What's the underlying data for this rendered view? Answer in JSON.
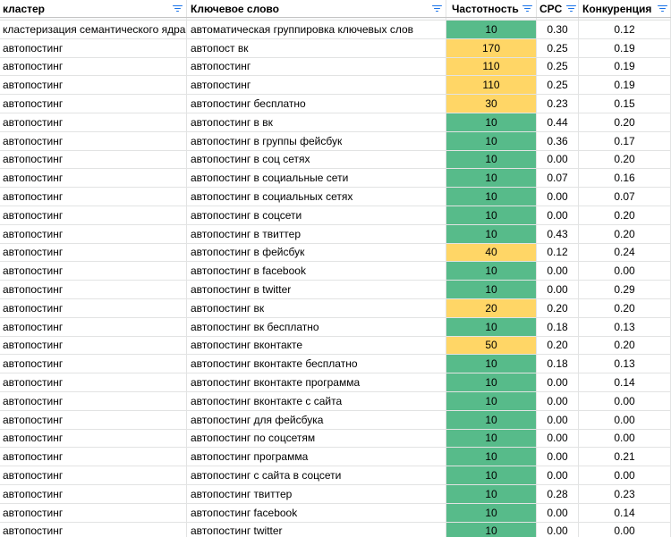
{
  "colors": {
    "high_frequency": "#ffd666",
    "low_frequency": "#57bb8a",
    "filter_icon": "#1a73e8"
  },
  "headers": [
    "кластер",
    "Ключевое слово",
    "Частотность",
    "CPC",
    "Конкуренция"
  ],
  "rows": [
    [
      "кластеризация семантического ядра",
      "автоматическая группировка ключевых слов",
      "10",
      "0.30",
      "0.12"
    ],
    [
      "автопостинг",
      "автопост вк",
      "170",
      "0.25",
      "0.19"
    ],
    [
      "автопостинг",
      "автопостинг",
      "110",
      "0.25",
      "0.19"
    ],
    [
      "автопостинг",
      "автопостинг",
      "110",
      "0.25",
      "0.19"
    ],
    [
      "автопостинг",
      "автопостинг бесплатно",
      "30",
      "0.23",
      "0.15"
    ],
    [
      "автопостинг",
      "автопостинг в вк",
      "10",
      "0.44",
      "0.20"
    ],
    [
      "автопостинг",
      "автопостинг в группы фейсбук",
      "10",
      "0.36",
      "0.17"
    ],
    [
      "автопостинг",
      "автопостинг в соц сетях",
      "10",
      "0.00",
      "0.20"
    ],
    [
      "автопостинг",
      "автопостинг в социальные сети",
      "10",
      "0.07",
      "0.16"
    ],
    [
      "автопостинг",
      "автопостинг в социальных сетях",
      "10",
      "0.00",
      "0.07"
    ],
    [
      "автопостинг",
      "автопостинг в соцсети",
      "10",
      "0.00",
      "0.20"
    ],
    [
      "автопостинг",
      "автопостинг в твиттер",
      "10",
      "0.43",
      "0.20"
    ],
    [
      "автопостинг",
      "автопостинг в фейсбук",
      "40",
      "0.12",
      "0.24"
    ],
    [
      "автопостинг",
      "автопостинг в facebook",
      "10",
      "0.00",
      "0.00"
    ],
    [
      "автопостинг",
      "автопостинг в twitter",
      "10",
      "0.00",
      "0.29"
    ],
    [
      "автопостинг",
      "автопостинг вк",
      "20",
      "0.20",
      "0.20"
    ],
    [
      "автопостинг",
      "автопостинг вк бесплатно",
      "10",
      "0.18",
      "0.13"
    ],
    [
      "автопостинг",
      "автопостинг вконтакте",
      "50",
      "0.20",
      "0.20"
    ],
    [
      "автопостинг",
      "автопостинг вконтакте бесплатно",
      "10",
      "0.18",
      "0.13"
    ],
    [
      "автопостинг",
      "автопостинг вконтакте программа",
      "10",
      "0.00",
      "0.14"
    ],
    [
      "автопостинг",
      "автопостинг вконтакте с сайта",
      "10",
      "0.00",
      "0.00"
    ],
    [
      "автопостинг",
      "автопостинг для фейсбука",
      "10",
      "0.00",
      "0.00"
    ],
    [
      "автопостинг",
      "автопостинг по соцсетям",
      "10",
      "0.00",
      "0.00"
    ],
    [
      "автопостинг",
      "автопостинг программа",
      "10",
      "0.00",
      "0.21"
    ],
    [
      "автопостинг",
      "автопостинг с сайта в соцсети",
      "10",
      "0.00",
      "0.00"
    ],
    [
      "автопостинг",
      "автопостинг твиттер",
      "10",
      "0.28",
      "0.23"
    ],
    [
      "автопостинг",
      "автопостинг facebook",
      "10",
      "0.00",
      "0.14"
    ],
    [
      "автопостинг",
      "автопостинг twitter",
      "10",
      "0.00",
      "0.00"
    ]
  ]
}
